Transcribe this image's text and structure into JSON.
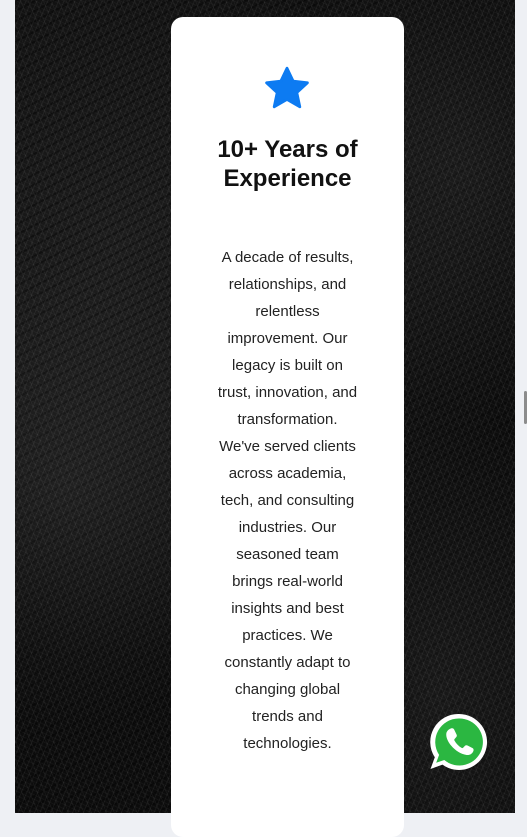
{
  "card": {
    "icon": "star-icon",
    "title": "10+ Years of Experience",
    "description": "A decade of results, relationships, and relentless improvement. Our legacy is built on trust, innovation, and transformation. We've served clients across academia, tech, and consulting industries. Our seasoned team brings real-world insights and best practices. We constantly adapt to changing global trends and technologies."
  },
  "floating_button": {
    "icon": "whatsapp-icon"
  },
  "colors": {
    "accent": "#0d7bf2",
    "whatsapp": "#2bb741",
    "card_background": "#ffffff",
    "page_background": "#eef0f4"
  }
}
